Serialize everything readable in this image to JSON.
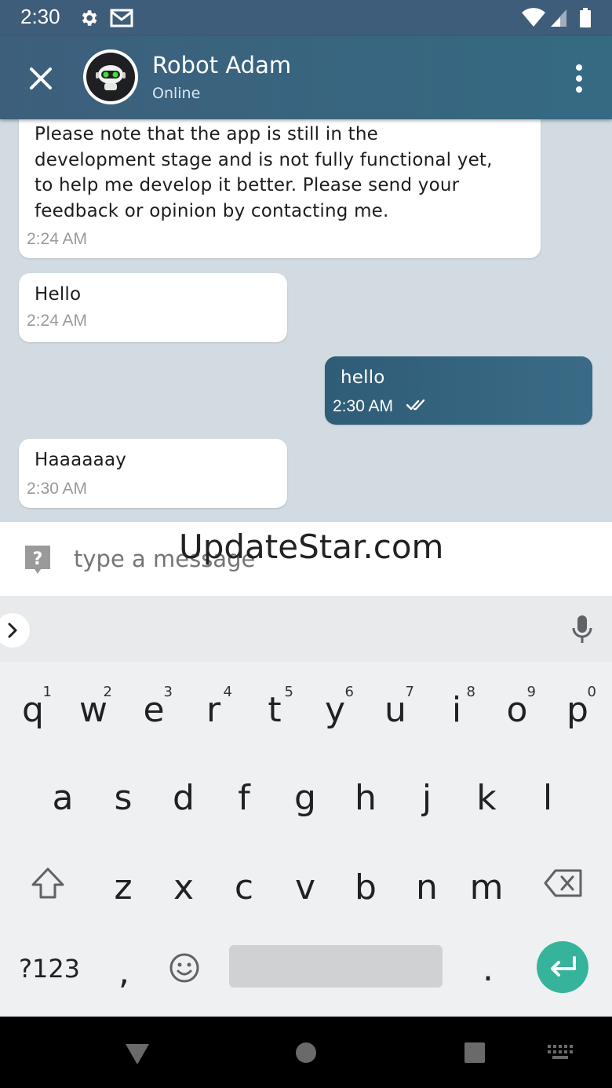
{
  "status_bar": {
    "time": "2:30",
    "icons": [
      "settings-icon",
      "gmail-icon",
      "wifi-icon",
      "signal-icon",
      "battery-icon"
    ]
  },
  "toolbar": {
    "close_icon": "close-icon",
    "contact_name": "Robot Adam",
    "contact_status": "Online",
    "more_icon": "more-vert-icon"
  },
  "messages": [
    {
      "direction": "incoming",
      "lines": [
        "Please note that the app is still in the",
        "development stage and is not fully functional yet,",
        "to help me develop it better. Please send your",
        "feedback or opinion by contacting me."
      ],
      "time": "2:24 AM"
    },
    {
      "direction": "incoming",
      "lines": [
        "Hello"
      ],
      "time": "2:24 AM"
    },
    {
      "direction": "outgoing",
      "lines": [
        "hello"
      ],
      "time": "2:30 AM",
      "status": "read-double-check"
    },
    {
      "direction": "incoming",
      "lines": [
        "Haaaaaay"
      ],
      "time": "2:30 AM"
    }
  ],
  "composer": {
    "placeholder": "type a message",
    "help_icon": "help-icon"
  },
  "watermark": "UpdateStar.com",
  "keyboard": {
    "row1": [
      {
        "ch": "q",
        "num": "1"
      },
      {
        "ch": "w",
        "num": "2"
      },
      {
        "ch": "e",
        "num": "3"
      },
      {
        "ch": "r",
        "num": "4"
      },
      {
        "ch": "t",
        "num": "5"
      },
      {
        "ch": "y",
        "num": "6"
      },
      {
        "ch": "u",
        "num": "7"
      },
      {
        "ch": "i",
        "num": "8"
      },
      {
        "ch": "o",
        "num": "9"
      },
      {
        "ch": "p",
        "num": "0"
      }
    ],
    "row2": [
      "a",
      "s",
      "d",
      "f",
      "g",
      "h",
      "j",
      "k",
      "l"
    ],
    "row3": [
      "z",
      "x",
      "c",
      "v",
      "b",
      "n",
      "m"
    ],
    "symbols_label": "?123",
    "comma": ",",
    "period": "."
  },
  "colors": {
    "toolbar": "#356a82",
    "chat_background": "#d3dbe2",
    "outgoing_bubble": "#2f5c76",
    "enter_key": "#35b49b"
  }
}
